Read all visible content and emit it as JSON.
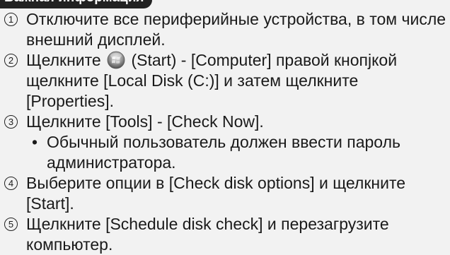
{
  "header": {
    "title": "Важная информация"
  },
  "steps": [
    {
      "number": "1",
      "text": "Отключите все периферийные устройства, в том числе внешний дисплей."
    },
    {
      "number": "2",
      "text_before_icon": "Щелкните",
      "icon": "windows-start-orb",
      "text_after_icon": "(Start) - [Computer] правой кноп­jкой щелкните [Local Disk (C:)] и затем щелкните [Properties]."
    },
    {
      "number": "3",
      "text": "Щелкните [Tools] - [Check Now].",
      "bullet": "Обычный пользователь должен ввести пароль администратора."
    },
    {
      "number": "4",
      "text": "Выберите опции в [Check disk options] и щелкните [Start]."
    },
    {
      "number": "5",
      "text": "Щелкните [Schedule disk check] и перезагрузите компьютер."
    }
  ]
}
